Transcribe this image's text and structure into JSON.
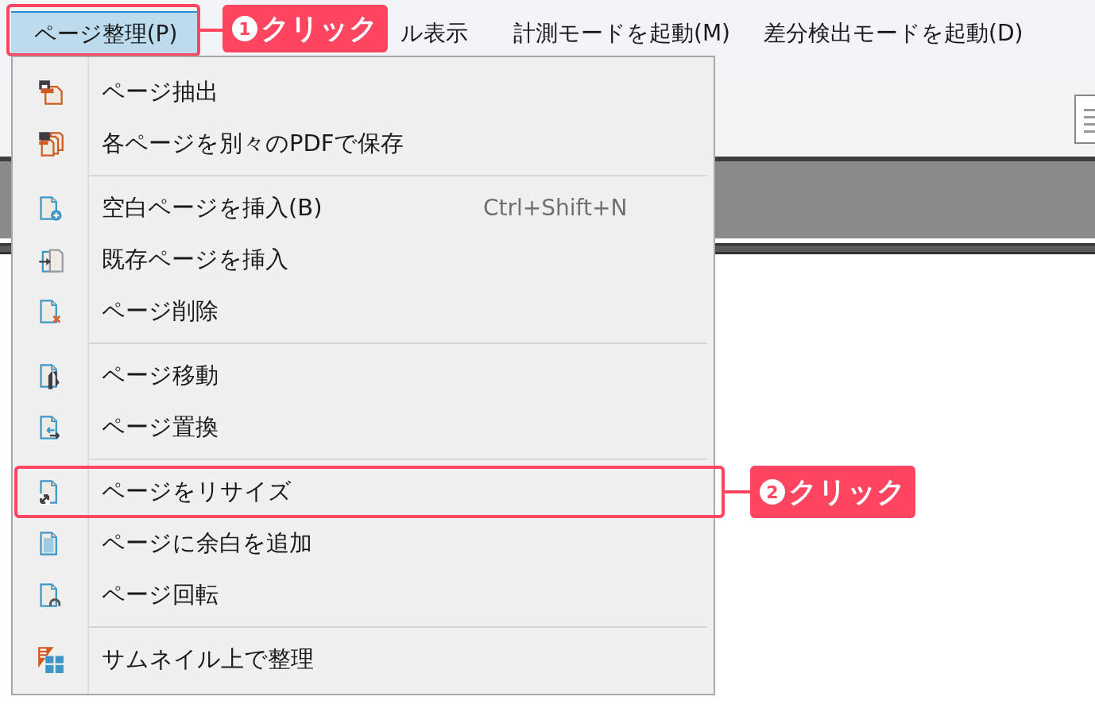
{
  "menu_bar": {
    "items": [
      {
        "label": "ページ整理(P)",
        "selected": true,
        "outlined": true
      },
      {
        "label": "ル表示",
        "selected": false,
        "outlined": false
      },
      {
        "label": "計測モードを起動(M)",
        "selected": false,
        "outlined": false
      },
      {
        "label": "差分検出モードを起動(D)",
        "selected": false,
        "outlined": false
      }
    ]
  },
  "dropdown": {
    "groups": [
      [
        {
          "label": "ページ抽出",
          "outlined": false
        },
        {
          "label": "各ページを別々のPDFで保存",
          "outlined": false
        }
      ],
      [
        {
          "label": "空白ページを挿入(B)",
          "shortcut": "Ctrl+Shift+N",
          "outlined": false
        },
        {
          "label": "既存ページを挿入",
          "outlined": false
        },
        {
          "label": "ページ削除",
          "outlined": false
        }
      ],
      [
        {
          "label": "ページ移動",
          "outlined": false
        },
        {
          "label": "ページ置換",
          "outlined": false
        }
      ],
      [
        {
          "label": "ページをリサイズ",
          "outlined": true
        },
        {
          "label": "ページに余白を追加",
          "outlined": false
        },
        {
          "label": "ページ回転",
          "outlined": false
        }
      ],
      [
        {
          "label": "サムネイル上で整理",
          "outlined": false
        }
      ]
    ]
  },
  "callouts": [
    {
      "number": "1",
      "text": "クリック"
    },
    {
      "number": "2",
      "text": "クリック"
    }
  ]
}
